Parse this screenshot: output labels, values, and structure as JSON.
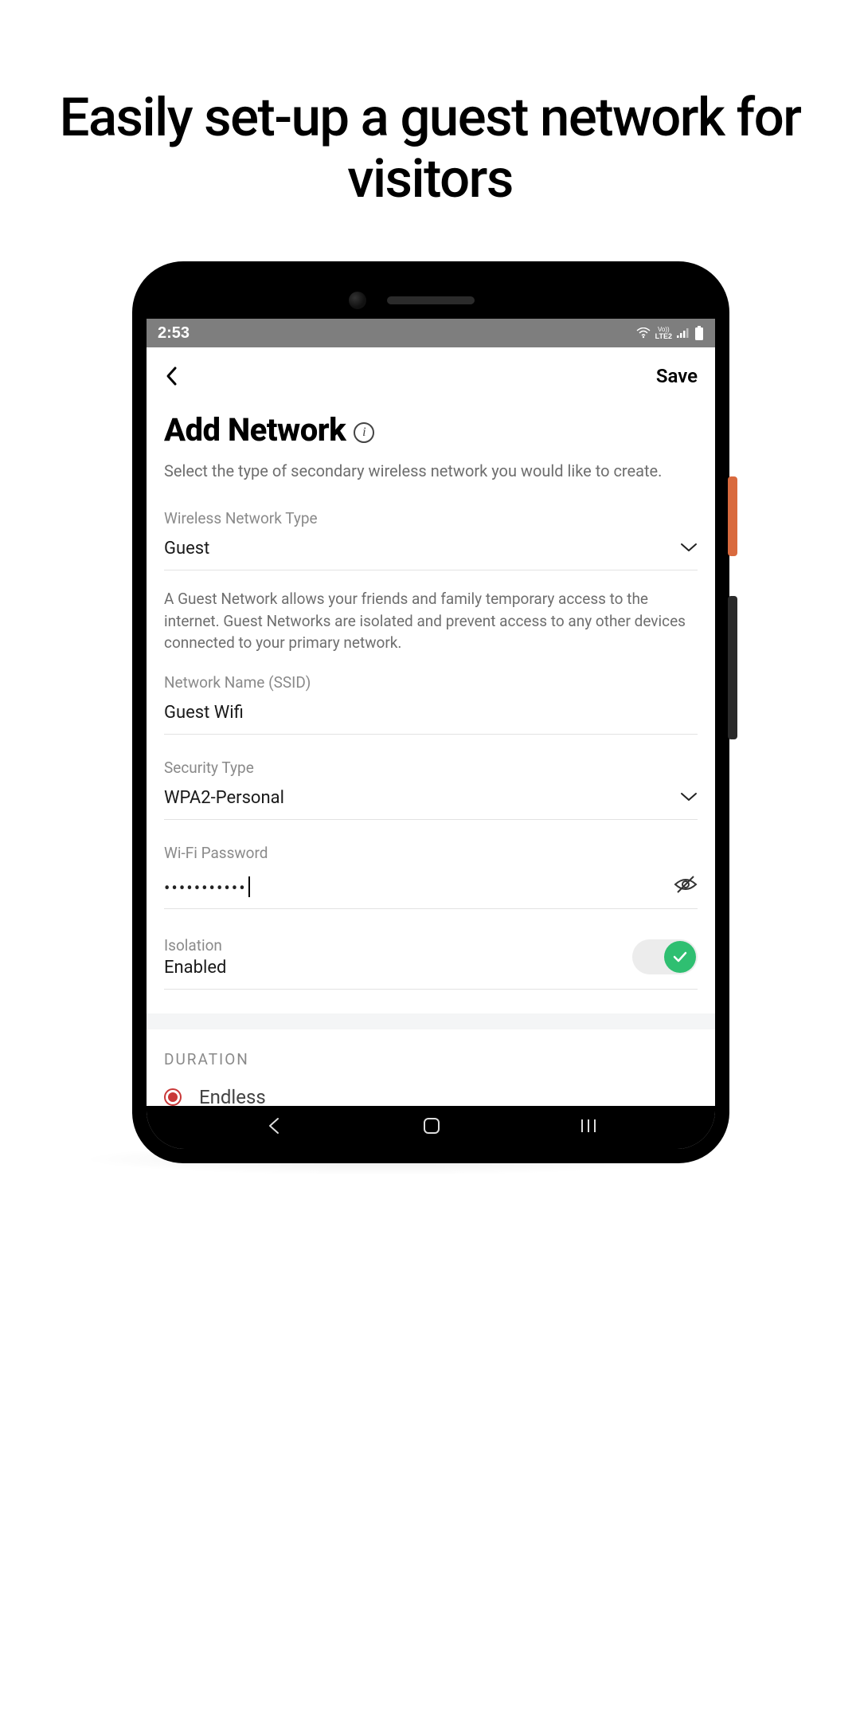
{
  "headline": "Easily set-up a guest network for visitors",
  "status": {
    "time": "2:53",
    "lte": "LTE2"
  },
  "nav": {
    "save_label": "Save"
  },
  "page": {
    "title": "Add Network",
    "info_glyph": "i",
    "subtitle": "Select the type of secondary wireless network you would like to create."
  },
  "fields": {
    "type": {
      "label": "Wireless Network Type",
      "value": "Guest"
    },
    "type_helper": "A Guest Network allows your friends and family temporary access to the internet. Guest Networks are isolated and prevent access to any other devices connected to your primary network.",
    "ssid": {
      "label": "Network Name (SSID)",
      "value": "Guest Wifi"
    },
    "security": {
      "label": "Security Type",
      "value": "WPA2-Personal"
    },
    "password": {
      "label": "Wi-Fi Password",
      "masked": "•••••••••••"
    },
    "isolation": {
      "label": "Isolation",
      "value": "Enabled"
    }
  },
  "duration": {
    "section": "DURATION",
    "option": "Endless"
  }
}
